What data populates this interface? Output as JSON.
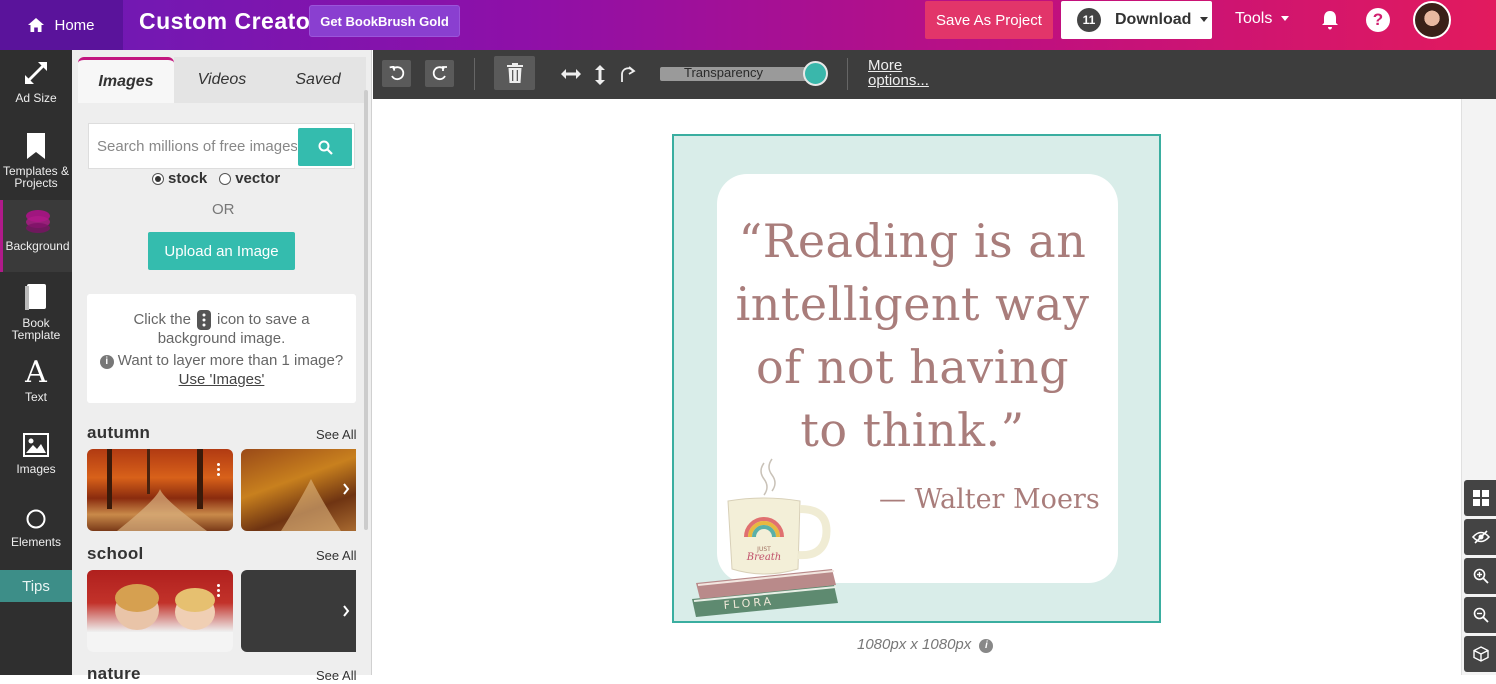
{
  "topbar": {
    "home_label": "Home",
    "app_title": "Custom Creator",
    "gold_label": "Get BookBrush Gold",
    "save_label": "Save As Project",
    "download_count": "11",
    "download_label": "Download",
    "tools_label": "Tools"
  },
  "rail": {
    "items": [
      {
        "label": "Ad Size"
      },
      {
        "label": "Templates & Projects"
      },
      {
        "label": "Background"
      },
      {
        "label": "Book Template"
      },
      {
        "label": "Text"
      },
      {
        "label": "Images"
      },
      {
        "label": "Elements"
      }
    ],
    "tips_label": "Tips"
  },
  "panel": {
    "tabs": [
      "Images",
      "Videos",
      "Saved"
    ],
    "search_placeholder": "Search millions of free images",
    "radio_stock": "stock",
    "radio_vector": "vector",
    "or_text": "OR",
    "upload_label": "Upload an Image",
    "tip_click": "Click the",
    "tip_icon_rest": "icon to save a",
    "tip_bg": "background image.",
    "tip_layer": "Want to layer more than 1 image?",
    "tip_link": "Use 'Images'",
    "categories": [
      {
        "title": "autumn",
        "see_all": "See All"
      },
      {
        "title": "school",
        "see_all": "See All"
      },
      {
        "title": "nature",
        "see_all": "See All"
      }
    ]
  },
  "toolbar": {
    "transparency_label": "Transparency",
    "more_options": "More options..."
  },
  "canvas": {
    "quote_lines": [
      "“Reading is an",
      "intelligent way",
      "of not having",
      "to think.”"
    ],
    "author": "— Walter Moers",
    "mug_text_1": "JUST",
    "mug_text_2": "Breath",
    "book_label": "FLORA",
    "dimensions": "1080px x 1080px"
  },
  "colors": {
    "accent_teal": "#34bcae",
    "quote_color": "#a97d7b",
    "design_bg": "#d9ede9"
  }
}
